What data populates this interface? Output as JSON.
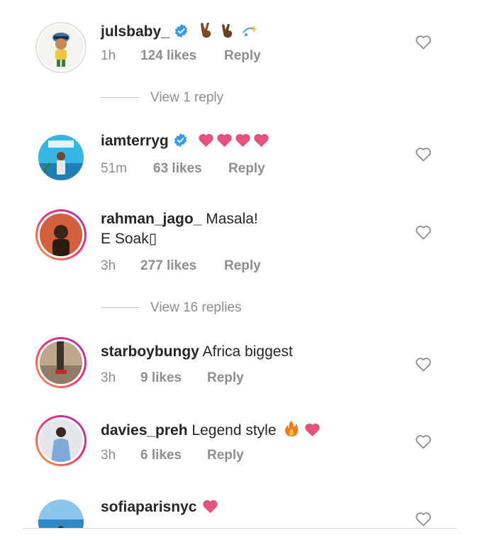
{
  "comments": [
    {
      "username": "julsbaby_",
      "text": "",
      "second_line": "",
      "time": "1h",
      "likes": "124 likes",
      "reply": "Reply",
      "verified": true,
      "emojis": [
        "victory-hand-icon",
        "victory-hand-icon",
        "sparkle-icon"
      ]
    },
    {
      "username": "iamterryg",
      "text": "",
      "second_line": "",
      "time": "51m",
      "likes": "63 likes",
      "reply": "Reply",
      "verified": true,
      "emojis": [
        "heart-icon",
        "heart-icon",
        "heart-icon",
        "heart-icon"
      ]
    },
    {
      "username": "rahman_jago_",
      "text": "Masala!",
      "second_line": "E Soak▯",
      "time": "3h",
      "likes": "277 likes",
      "reply": "Reply",
      "verified": false
    },
    {
      "username": "starboybungy",
      "text": "Africa biggest",
      "second_line": "",
      "time": "3h",
      "likes": "9 likes",
      "reply": "Reply",
      "verified": false
    },
    {
      "username": "davies_preh",
      "text": "Legend style",
      "second_line": "",
      "time": "3h",
      "likes": "6 likes",
      "reply": "Reply",
      "verified": false,
      "emojis": [
        "fire-icon",
        "heart-icon"
      ]
    },
    {
      "username": "sofiaparisnyc",
      "text": "",
      "second_line": "",
      "verified": false,
      "emojis": [
        "heart-icon"
      ]
    }
  ],
  "view_replies": [
    {
      "label": "View 1 reply"
    },
    {
      "label": "View 16 replies"
    }
  ],
  "colors": {
    "text_primary": "#262626",
    "text_secondary": "#8e8e8e",
    "verified_blue": "#3897f0",
    "heart_pink": "#e8517d",
    "story_ring_start": "#f9a03a",
    "story_ring_end": "#ee2a7b"
  }
}
